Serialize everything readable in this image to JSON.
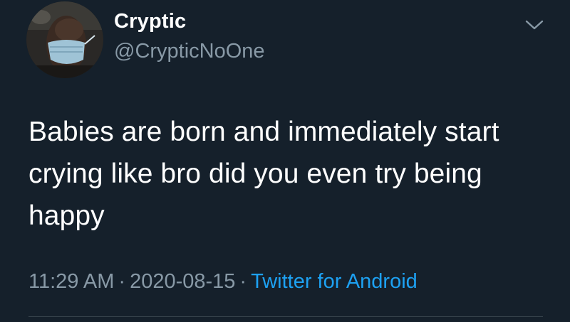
{
  "user": {
    "display_name": "Cryptic",
    "handle": "@CrypticNoOne"
  },
  "tweet": {
    "text": "Babies are born and immediately start crying like bro did you even try being happy",
    "time": "11:29 AM",
    "date": "2020-08-15",
    "separator": "·",
    "source": "Twitter for Android"
  },
  "icons": {
    "menu": "chevron-down-icon"
  },
  "colors": {
    "background": "#15202b",
    "primary_text": "#ffffff",
    "secondary_text": "#8899a6",
    "link": "#1da1f2"
  }
}
